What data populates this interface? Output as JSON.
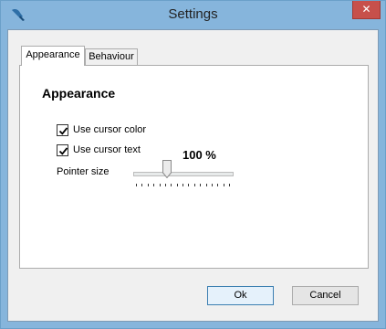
{
  "window": {
    "title": "Settings",
    "close_label": "✕"
  },
  "tabs": [
    {
      "label": "Appearance",
      "active": true
    },
    {
      "label": "Behaviour",
      "active": false
    }
  ],
  "appearance": {
    "section_title": "Appearance",
    "use_cursor_color": {
      "label": "Use cursor color",
      "checked": true
    },
    "use_cursor_text": {
      "label": "Use cursor text",
      "checked": true
    },
    "pointer_size": {
      "label": "Pointer size",
      "value_text": "100 %",
      "level_fraction": 0.33,
      "tick_count": 17
    }
  },
  "buttons": {
    "ok": "Ok",
    "cancel": "Cancel"
  },
  "icons": {
    "app": "mouse-cursor-icon",
    "check": "checkmark-icon",
    "close": "close-icon"
  }
}
